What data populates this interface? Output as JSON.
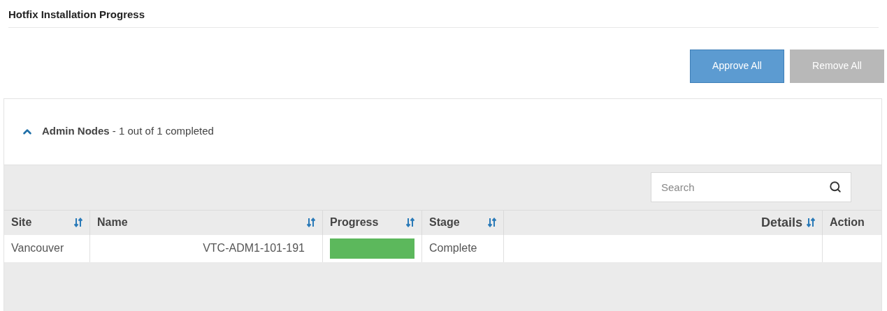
{
  "title": "Hotfix Installation Progress",
  "buttons": [
    {
      "label": "Approve All",
      "disabled": false
    },
    {
      "label": "Remove All",
      "disabled": true
    }
  ],
  "section": {
    "title": "Admin Nodes",
    "summary": " - 1 out of 1 completed",
    "expanded": true,
    "search": {
      "placeholder": "Search"
    },
    "table": {
      "columns": [
        {
          "label": "Site",
          "sortable": true
        },
        {
          "label": "Name",
          "sortable": true
        },
        {
          "label": "Progress",
          "sortable": true
        },
        {
          "label": "Stage",
          "sortable": true
        },
        {
          "label": "Details",
          "sortable": true
        },
        {
          "label": "Action",
          "sortable": false
        }
      ],
      "rows": [
        {
          "site": "Vancouver",
          "name": "VTC-ADM1-101-191",
          "progress": {
            "level": 1
          },
          "stage": "Complete"
        }
      ]
    }
  }
}
